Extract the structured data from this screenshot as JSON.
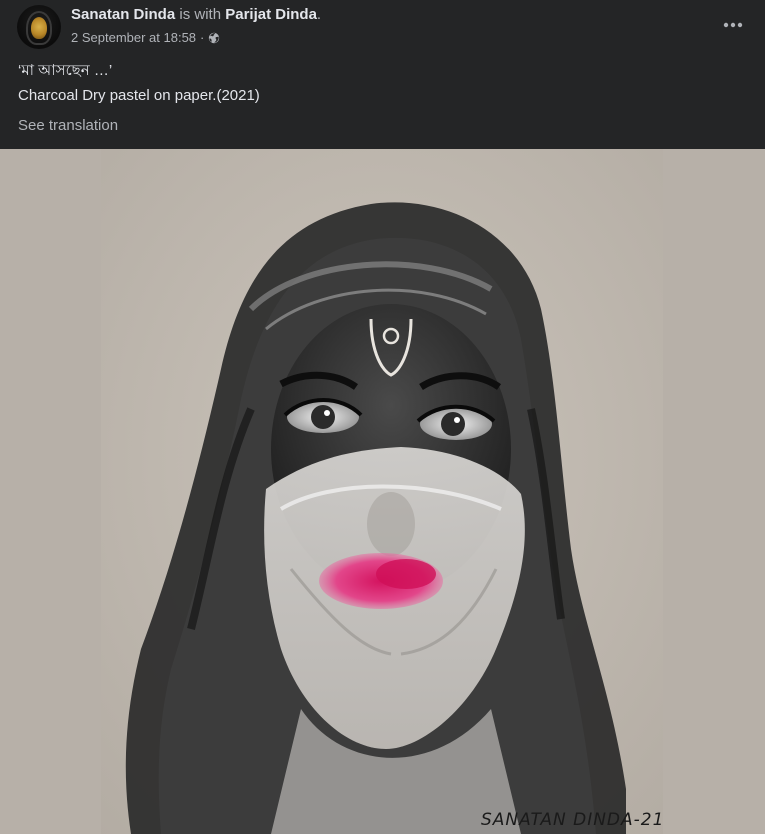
{
  "post": {
    "author_name": "Sanatan Dinda",
    "with_text": "is with",
    "tagged_name": "Parijat Dinda",
    "period": ".",
    "timestamp": "2 September at 18:58",
    "separator": "·",
    "audience_icon": "globe-icon",
    "caption_line1": "‘মা আসছেন …’",
    "caption_line2": "Charcoal Dry pastel on paper.(2021)",
    "see_translation": "See translation",
    "more_icon": "more-horizontal-icon"
  },
  "artwork": {
    "signature": "SANATAN DINDA-21"
  },
  "colors": {
    "background": "#242526",
    "primary_text": "#e4e6eb",
    "secondary_text": "#b0b3b8",
    "media_background": "#b7b0a8"
  }
}
